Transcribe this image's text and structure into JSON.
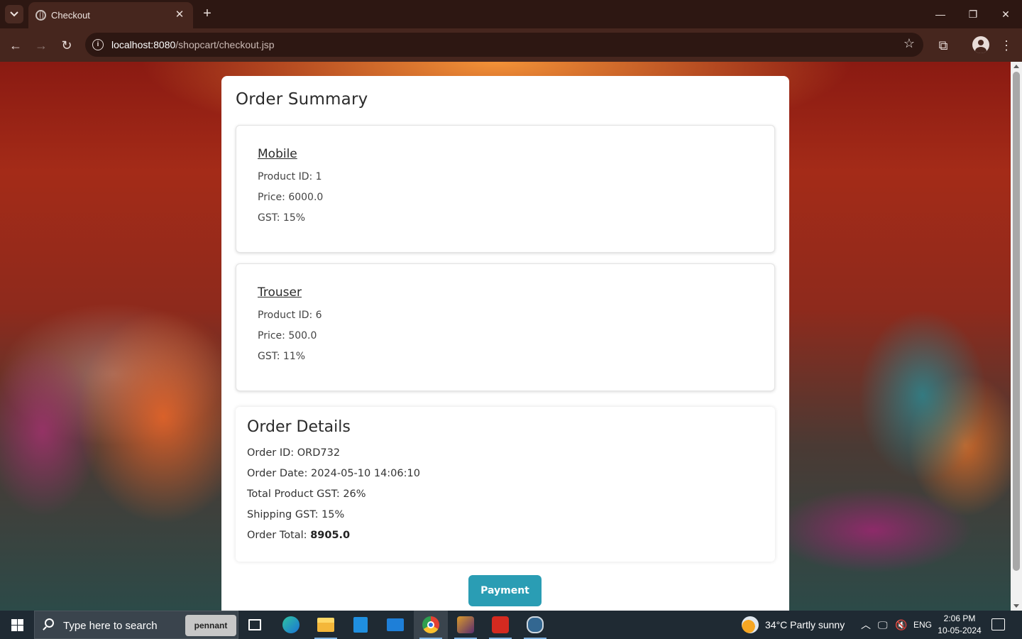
{
  "browser": {
    "tab_title": "Checkout",
    "url_host": "localhost:8080",
    "url_path": "/shopcart/checkout.jsp"
  },
  "page": {
    "title": "Order Summary",
    "products": [
      {
        "name": "Mobile",
        "product_id": "Product ID: 1",
        "price": "Price: 6000.0",
        "gst": "GST: 15%"
      },
      {
        "name": "Trouser",
        "product_id": "Product ID: 6",
        "price": "Price: 500.0",
        "gst": "GST: 11%"
      }
    ],
    "order_details": {
      "title": "Order Details",
      "order_id": "Order ID: ORD732",
      "order_date": "Order Date: 2024-05-10 14:06:10",
      "total_product_gst": "Total Product GST: 26%",
      "shipping_gst": "Shipping GST: 15%",
      "order_total_label": "Order Total:",
      "order_total_value": "8905.0"
    },
    "payment_button": "Payment"
  },
  "taskbar": {
    "search_placeholder": "Type here to search",
    "search_promo": "pennant",
    "weather": "34°C  Partly sunny",
    "language": "ENG",
    "time": "2:06 PM",
    "date": "10-05-2024"
  },
  "colors": {
    "accent_button": "#2a9db4",
    "browser_frame": "#46261e"
  }
}
